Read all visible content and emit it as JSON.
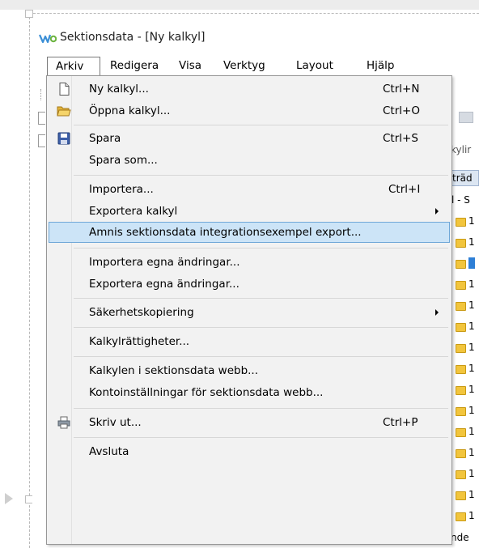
{
  "window": {
    "title": "Sektionsdata - [Ny kalkyl]",
    "icon": "sektionsdata-logo-icon"
  },
  "menubar": {
    "items": [
      {
        "label": "Arkiv",
        "active": true
      },
      {
        "label": "Redigera"
      },
      {
        "label": "Visa"
      },
      {
        "label": "Verktyg"
      },
      {
        "label": "Layout"
      },
      {
        "label": "Hjälp"
      }
    ]
  },
  "file_menu": {
    "items": [
      {
        "label": "Ny kalkyl...",
        "shortcut": "Ctrl+N",
        "icon": "new-document-icon"
      },
      {
        "label": "Öppna kalkyl...",
        "shortcut": "Ctrl+O",
        "icon": "open-folder-icon"
      },
      {
        "label": "Spara",
        "shortcut": "Ctrl+S",
        "icon": "save-disk-icon"
      },
      {
        "label": "Spara som...",
        "shortcut": ""
      },
      {
        "label": "Importera...",
        "shortcut": "Ctrl+I"
      },
      {
        "label": "Exportera kalkyl",
        "shortcut": "",
        "submenu": true
      },
      {
        "label": "Amnis sektionsdata integrationsexempel export...",
        "shortcut": "",
        "highlighted": true
      },
      {
        "label": "Importera egna ändringar...",
        "shortcut": ""
      },
      {
        "label": "Exportera egna ändringar...",
        "shortcut": ""
      },
      {
        "label": "Säkerhetskopiering",
        "shortcut": "",
        "submenu": true
      },
      {
        "label": "Kalkylrättigheter...",
        "shortcut": ""
      },
      {
        "label": "Kalkylen i sektionsdata webb...",
        "shortcut": ""
      },
      {
        "label": "Kontoinställningar för sektionsdata webb...",
        "shortcut": ""
      },
      {
        "label": "Skriv ut...",
        "shortcut": "Ctrl+P",
        "icon": "printer-icon"
      },
      {
        "label": "Avsluta",
        "shortcut": ""
      }
    ]
  },
  "background": {
    "tab_fragment": "kylir",
    "header_fragment": "träd",
    "tree_label_fragment": "l - S",
    "folder_digit": "1",
    "bottom_fragment": "nde",
    "colors": {
      "folder": "#f2c53d",
      "selection": "#2e7fd6",
      "header": "#dce6f2"
    }
  },
  "colors": {
    "menu_bg": "#f2f2f2",
    "highlight_bg": "#cce4f7",
    "highlight_border": "#6fa7d8"
  }
}
